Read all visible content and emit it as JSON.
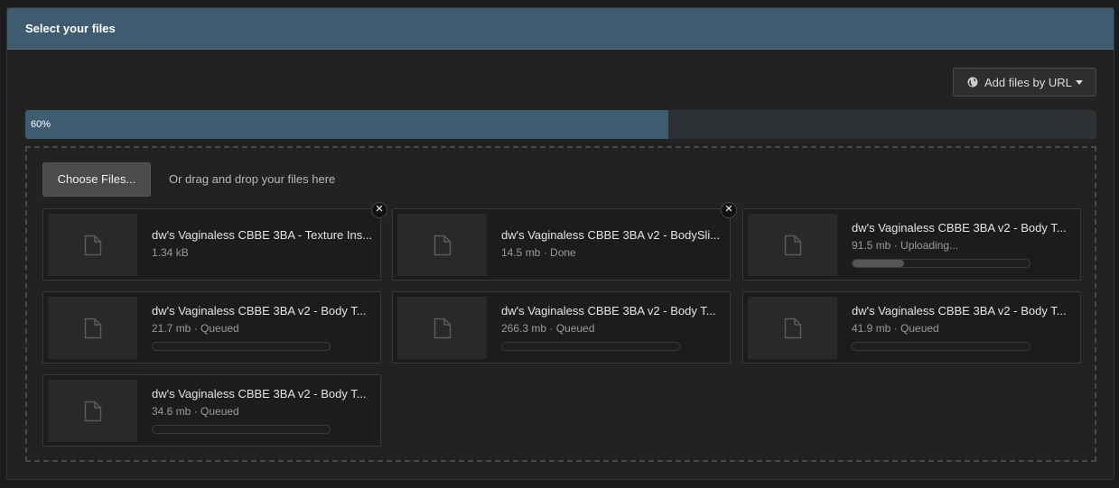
{
  "header": {
    "title": "Select your files"
  },
  "url_button": {
    "label": "Add files by URL",
    "icon": "globe-icon"
  },
  "overall_progress": {
    "percent": 60,
    "label": "60%"
  },
  "dropzone": {
    "choose_label": "Choose Files...",
    "drag_text": "Or drag and drop your files here"
  },
  "files": [
    {
      "name": "dw's Vaginaless CBBE 3BA - Texture Ins...",
      "meta": "1.34 kB",
      "progress": null,
      "removable": true
    },
    {
      "name": "dw's Vaginaless CBBE 3BA v2 - BodySli...",
      "meta": "14.5 mb · Done",
      "progress": null,
      "removable": true
    },
    {
      "name": "dw's Vaginaless CBBE 3BA v2 - Body T...",
      "meta": "91.5 mb · Uploading...",
      "progress": 0.29,
      "removable": false
    },
    {
      "name": "dw's Vaginaless CBBE 3BA v2 - Body T...",
      "meta": "21.7 mb · Queued",
      "progress": 0,
      "removable": false
    },
    {
      "name": "dw's Vaginaless CBBE 3BA v2 - Body T...",
      "meta": "266.3 mb · Queued",
      "progress": 0,
      "removable": false
    },
    {
      "name": "dw's Vaginaless CBBE 3BA v2 - Body T...",
      "meta": "41.9 mb · Queued",
      "progress": 0,
      "removable": false
    },
    {
      "name": "dw's Vaginaless CBBE 3BA v2 - Body T...",
      "meta": "34.6 mb · Queued",
      "progress": 0,
      "removable": false
    }
  ],
  "colors": {
    "header_bg": "#3f5b70",
    "progress_fill": "#3f5b70",
    "panel_bg": "#222222"
  }
}
